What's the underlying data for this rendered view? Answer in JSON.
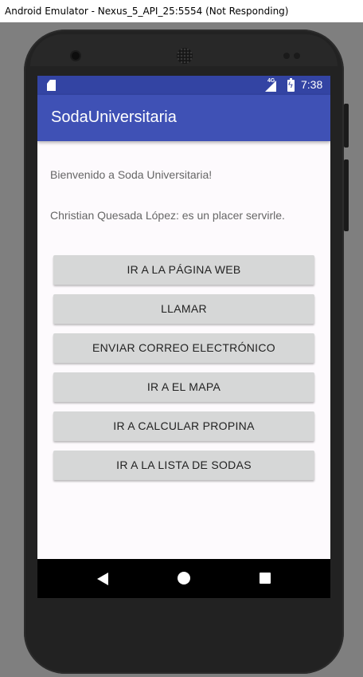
{
  "window": {
    "title": "Android Emulator - Nexus_5_API_25:5554 (Not Responding)"
  },
  "status_bar": {
    "network_label": "4G",
    "time": "7:38",
    "icons": [
      "sd-card-icon",
      "signal-icon",
      "battery-charging-icon"
    ]
  },
  "app_bar": {
    "title": "SodaUniversitaria"
  },
  "content": {
    "welcome_text": "Bienvenido a Soda Universitaria!",
    "owner_text": "Christian Quesada López: es un placer servirle."
  },
  "buttons": [
    {
      "label": "IR A LA PÁGINA WEB"
    },
    {
      "label": "LLAMAR"
    },
    {
      "label": "ENVIAR CORREO ELECTRÓNICO"
    },
    {
      "label": "IR A EL MAPA"
    },
    {
      "label": "IR A CALCULAR PROPINA"
    },
    {
      "label": "IR A LA LISTA DE SODAS"
    }
  ],
  "nav_bar": {
    "icons": [
      "back-icon",
      "home-icon",
      "recents-icon"
    ]
  },
  "colors": {
    "primary": "#3f51b5",
    "primary_dark": "#3344a3",
    "button": "#d6d7d7",
    "background": "#fdfafd"
  }
}
